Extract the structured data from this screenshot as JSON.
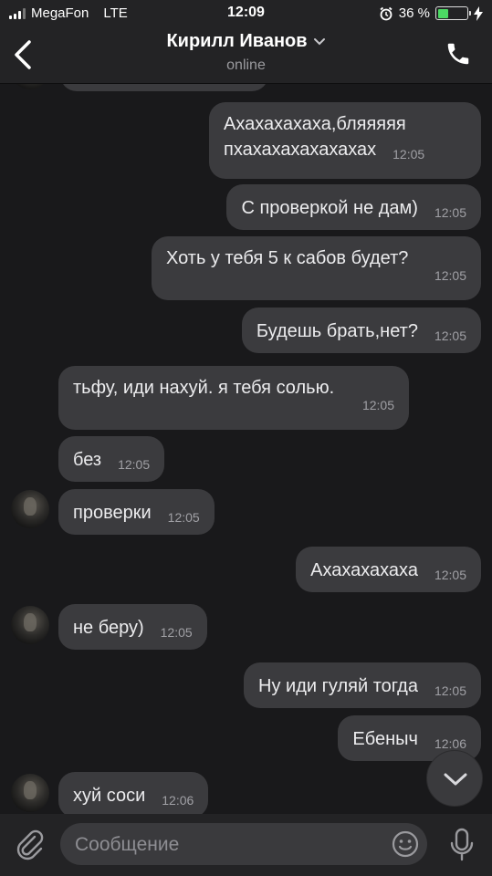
{
  "status": {
    "carrier": "MegaFon",
    "network": "LTE",
    "time": "12:09",
    "battery": "36 %",
    "battery_level": 0.36
  },
  "header": {
    "title": "Кирилл Иванов",
    "subtitle": "online"
  },
  "messages": [
    {
      "text1": "Ахахахахаха,бляяяяя",
      "text2": "пхахахахахахахах",
      "time": "12:05",
      "side": "out"
    },
    {
      "text": "С проверкой не дам)",
      "time": "12:05",
      "side": "out"
    },
    {
      "text": "Хоть у тебя 5 к сабов будет?",
      "time": "12:05",
      "side": "out"
    },
    {
      "text": "Будешь брать,нет?",
      "time": "12:05",
      "side": "out"
    },
    {
      "text": "тьфу, иди нахуй. я тебя солью.",
      "time": "12:05",
      "side": "in"
    },
    {
      "text": "без",
      "time": "12:05",
      "side": "in"
    },
    {
      "text": "проверки",
      "time": "12:05",
      "side": "in"
    },
    {
      "text": "Ахахахахаха",
      "time": "12:05",
      "side": "out"
    },
    {
      "text": "не беру)",
      "time": "12:05",
      "side": "in"
    },
    {
      "text": "Ну иди гуляй тогда",
      "time": "12:05",
      "side": "out"
    },
    {
      "text": "Ебеныч",
      "time": "12:06",
      "side": "out"
    },
    {
      "text": "хуй соси",
      "time": "12:06",
      "side": "in"
    }
  ],
  "composer": {
    "placeholder": "Сообщение"
  },
  "colors": {
    "background": "#19191b",
    "bubble": "#3b3b3e",
    "bar": "#232325",
    "battery": "#4cd964"
  }
}
